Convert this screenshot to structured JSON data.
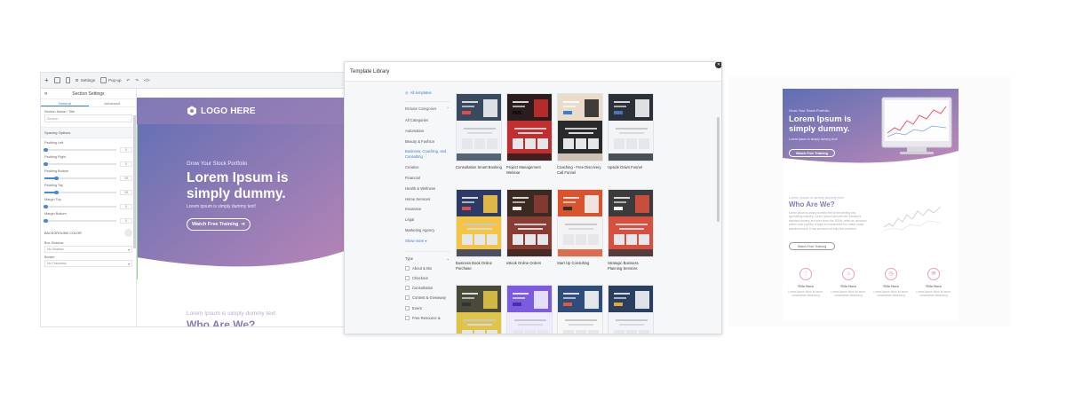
{
  "editor": {
    "toolbar": {
      "settings_label": "Settings",
      "popup_label": "Pop-up"
    },
    "sidebar": {
      "title": "Section Settings",
      "tabs": [
        "General",
        "Advanced"
      ],
      "section_name_label": "Section Name / Title",
      "section_name_placeholder": "Section",
      "spacing_heading": "Spacing Options",
      "sliders": [
        {
          "label": "Padding Left",
          "value": "0",
          "level": 0.0
        },
        {
          "label": "Padding Right",
          "value": "0",
          "level": 0.0
        },
        {
          "label": "Padding Bottom",
          "value": "15",
          "level": 0.15
        },
        {
          "label": "Padding Top",
          "value": "15",
          "level": 0.15
        },
        {
          "label": "Margin Top",
          "value": "0",
          "level": 0.0
        },
        {
          "label": "Margin Bottom",
          "value": "0",
          "level": 0.0
        }
      ],
      "background_label": "BACKGROUND COLOR",
      "box_shadow_label": "Box Shadow",
      "box_shadow_value": "No Shadow",
      "border_label": "Border",
      "border_value": "No Thickness"
    },
    "canvas": {
      "logo_text": "LOGO HERE",
      "hero_small": "Grow Your Stock Portfolio",
      "hero_title_line1": "Lorem Ipsum is",
      "hero_title_line2": "simply dummy.",
      "hero_sub": "Lorem ipsum is simply dummy text!",
      "hero_button": "Watch Free Training",
      "below_small": "Lorem Ipsum is simply dummy text",
      "below_title": "Who Are We?"
    }
  },
  "library": {
    "title": "Template Library",
    "all_templates": "All templates",
    "browse_categories": "Browse Categories",
    "categories": [
      "All Categories",
      "Automation",
      "Beauty & Fashion",
      "Business, Coaching, and Consulting",
      "Creative",
      "Financial",
      "Health & Wellness",
      "Home Services",
      "Insurance",
      "Legal",
      "Marketing Agency"
    ],
    "active_category": "Business, Coaching, and Consulting",
    "show_more": "Show more",
    "type_heading": "Type",
    "types": [
      "About & Bio",
      "Checkout",
      "Consultation",
      "Contest & Giveaway",
      "Event",
      "Free Resource &"
    ],
    "templates": [
      {
        "name": "Consultation Smart Booking"
      },
      {
        "name": "Project Management Webinar"
      },
      {
        "name": "Coaching - Free Discovery Call Funnel"
      },
      {
        "name": "Upside Down Funnel"
      },
      {
        "name": "Business Book Online Purchase"
      },
      {
        "name": "eBook Online Orders"
      },
      {
        "name": "Start Up Consulting"
      },
      {
        "name": "Strategic Business Planning Services"
      }
    ]
  },
  "preview": {
    "hero_small": "Grow Your Stock Portfolio",
    "hero_title_line1": "Lorem Ipsum is",
    "hero_title_line2": "simply dummy.",
    "hero_sub": "Lorem ipsum is simply dummy text!",
    "hero_button": "Watch Free Training",
    "who_small": "Lorem Ipsum is simply dummy text",
    "who_title": "Who Are We?",
    "who_text": "Lorem ipsum is simply dummy text of the printing and typesetting industry. Lorem Ipsum has been the industry's standard dummy text ever since the 1500s, when an unknown printer took a galley of type and scrambled it to make a type specimen book. It has survived not only five centuries.",
    "who_button": "Watch Free Training",
    "features": [
      {
        "title": "Title Here",
        "text": "Lorem ipsum dolor sit amet, consectetur adipiscing"
      },
      {
        "title": "Title Here",
        "text": "Lorem ipsum dolor sit amet, consectetur adipiscing"
      },
      {
        "title": "Title Here",
        "text": "Lorem ipsum dolor sit amet, consectetur adipiscing"
      },
      {
        "title": "Title Here",
        "text": "Lorem ipsum dolor sit amet, consectetur adipiscing"
      }
    ]
  },
  "colors": {
    "hero_start": "#5a6fb0",
    "hero_end": "#b583b5",
    "accent_blue": "#3e7bd6",
    "heading_purple": "#8a79b8",
    "feature_pink": "#d77c95"
  }
}
